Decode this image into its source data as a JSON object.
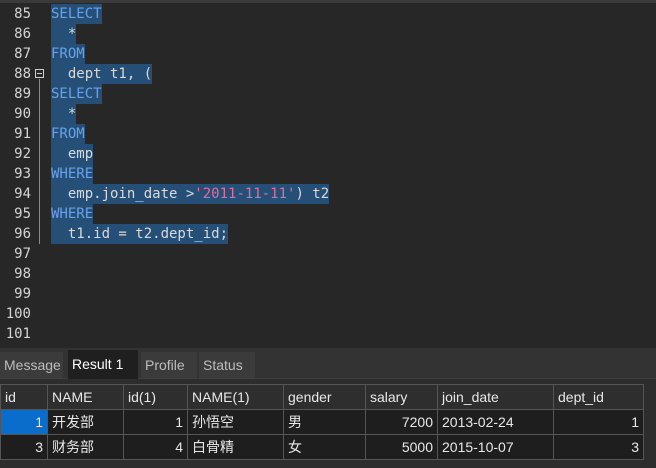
{
  "editor": {
    "lines": [
      {
        "n": "85",
        "tokens": [
          {
            "t": "SELECT",
            "c": "kw"
          }
        ],
        "sel": true
      },
      {
        "n": "86",
        "tokens": [
          {
            "t": "  *",
            "c": ""
          }
        ],
        "sel": true
      },
      {
        "n": "87",
        "tokens": [
          {
            "t": "FROM",
            "c": "kw"
          }
        ],
        "sel": true
      },
      {
        "n": "88",
        "tokens": [
          {
            "t": "  dept t1, (",
            "c": ""
          }
        ],
        "sel": true,
        "fold": true
      },
      {
        "n": "89",
        "tokens": [
          {
            "t": "SELECT",
            "c": "kw"
          }
        ],
        "sel": true
      },
      {
        "n": "90",
        "tokens": [
          {
            "t": "  *",
            "c": ""
          }
        ],
        "sel": true
      },
      {
        "n": "91",
        "tokens": [
          {
            "t": "FROM",
            "c": "kw"
          }
        ],
        "sel": true
      },
      {
        "n": "92",
        "tokens": [
          {
            "t": "  emp",
            "c": ""
          }
        ],
        "sel": true
      },
      {
        "n": "93",
        "tokens": [
          {
            "t": "WHERE",
            "c": "kw"
          }
        ],
        "sel": true
      },
      {
        "n": "94",
        "tokens": [
          {
            "t": "  emp.join_date >",
            "c": ""
          },
          {
            "t": "'2011-11-11'",
            "c": "str"
          },
          {
            "t": ") t2",
            "c": ""
          }
        ],
        "sel": true
      },
      {
        "n": "95",
        "tokens": [
          {
            "t": "WHERE",
            "c": "kw"
          }
        ],
        "sel": true
      },
      {
        "n": "96",
        "tokens": [
          {
            "t": "  t1.id = t2.dept_id;",
            "c": ""
          }
        ],
        "sel": true
      },
      {
        "n": "97",
        "tokens": [],
        "sel": false
      },
      {
        "n": "98",
        "tokens": [],
        "sel": false
      },
      {
        "n": "99",
        "tokens": [],
        "sel": false
      },
      {
        "n": "100",
        "tokens": [],
        "sel": false
      },
      {
        "n": "101",
        "tokens": [],
        "sel": false
      }
    ]
  },
  "tabs": [
    {
      "label": "Message",
      "active": false
    },
    {
      "label": "Result 1",
      "active": true
    },
    {
      "label": "Profile",
      "active": false
    },
    {
      "label": "Status",
      "active": false
    }
  ],
  "result": {
    "columns": [
      "id",
      "NAME",
      "id(1)",
      "NAME(1)",
      "gender",
      "salary",
      "join_date",
      "dept_id"
    ],
    "rows": [
      [
        "1",
        "开发部",
        "1",
        "孙悟空",
        "男",
        "7200",
        "2013-02-24",
        "1"
      ],
      [
        "3",
        "财务部",
        "4",
        "白骨精",
        "女",
        "5000",
        "2015-10-07",
        "3"
      ]
    ]
  }
}
